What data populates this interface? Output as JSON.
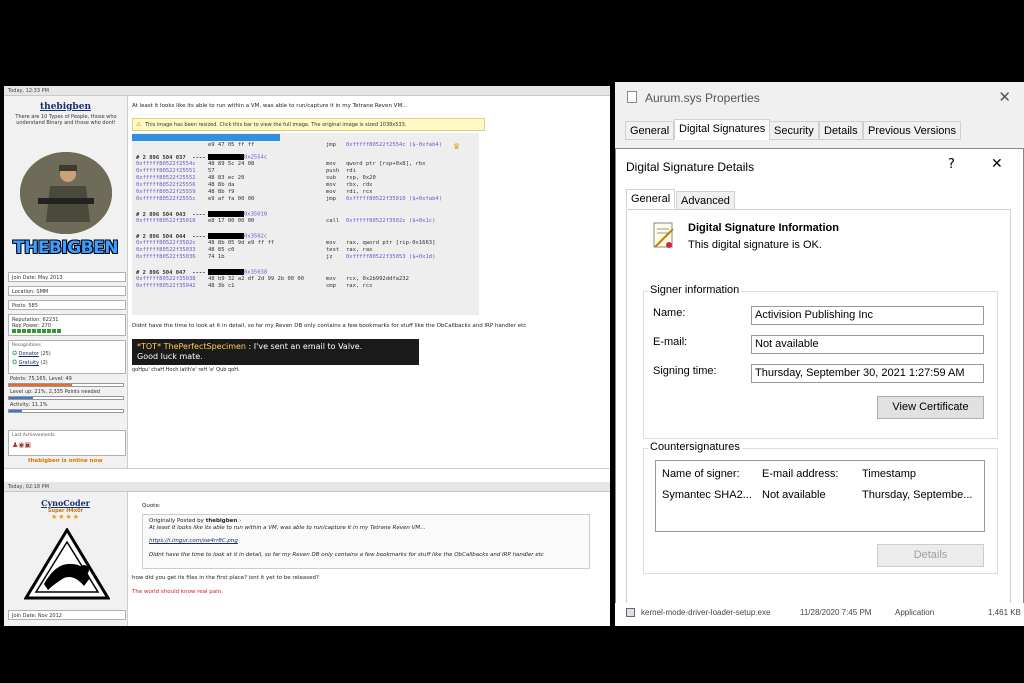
{
  "forum": {
    "post1": {
      "header": "Today, 12:33 PM",
      "username": "thebigben",
      "tagline": "There are 10 Types of People, those who understand Binary and those who dont!",
      "logo_text": "THEBIGBEN",
      "join_date": "Join Date: May 2013",
      "location": "Location: SMM",
      "posts": "Posts: 585",
      "reputation": "Reputation: 62231",
      "rep_power": "Rep Power: 270",
      "recognitions_title": "Recognitions",
      "recognitions": [
        {
          "label": "Donator",
          "count": "(25)"
        },
        {
          "label": "Gratuity",
          "count": "(2)"
        }
      ],
      "points": "Points: 75,165, Level: 49",
      "level_up": "Level up: 21%, 2,335 Points needed",
      "activity": "Activity: 11.1%",
      "points_fill": 0.55,
      "level_fill": 0.21,
      "activity_fill": 0.111,
      "achievements_title": "Last Achievements",
      "online_status": "thebigben is online now",
      "intro": "At least it looks like its able to run within a VM, was able to run/capture it in my Tetrane Reven VM...",
      "notice": "This image has been resized. Click this bar to view the full image. The original image is sized 1038x533.",
      "code_lines": [
        {
          "a": "# 2 896 504 036  ----",
          "b": "",
          "c": "",
          "d": ""
        },
        {
          "a": "",
          "b": "e9 47 05 ff ff",
          "c": "jmp",
          "d": "0xfffff80522f2554c ($-0xfab4)"
        },
        {
          "a": "# 2 896 504 037  ----",
          "b": "0x2554c",
          "c": "",
          "d": ""
        },
        {
          "a": "0xfffff80522f2554c",
          "b": "48 89 5c 24 08",
          "c": "mov",
          "d": "qword ptr [rsp+0x8], rbx"
        },
        {
          "a": "0xfffff80522f25551",
          "b": "57",
          "c": "push",
          "d": "rdi"
        },
        {
          "a": "0xfffff80522f25552",
          "b": "48 83 ec 20",
          "c": "sub",
          "d": "rsp, 0x20"
        },
        {
          "a": "0xfffff80522f25556",
          "b": "48 8b da",
          "c": "mov",
          "d": "rbx, rdx"
        },
        {
          "a": "0xfffff80522f25559",
          "b": "48 8b f9",
          "c": "mov",
          "d": "rdi, rcx"
        },
        {
          "a": "0xfffff80522f2555c",
          "b": "e9 af fa 00 00",
          "c": "jmp",
          "d": "0xfffff80522f35010 ($+0xfab4)"
        },
        {
          "a": "# 2 896 504 043  ----",
          "b": "0x35010",
          "c": "",
          "d": ""
        },
        {
          "a": "0xfffff80522f35010",
          "b": "e8 17 00 00 00",
          "c": "call",
          "d": "0xfffff80522f3502c ($+0x1c)"
        },
        {
          "a": "# 2 896 504 044  ----",
          "b": "0x3502c",
          "c": "",
          "d": ""
        },
        {
          "a": "0xfffff80522f3502c",
          "b": "48 8b 05 9d e9 ff ff",
          "c": "mov",
          "d": "rax, qword ptr [rip-0x1663]"
        },
        {
          "a": "0xfffff80522f35033",
          "b": "48 85 c0",
          "c": "test",
          "d": "rax, rax"
        },
        {
          "a": "0xfffff80522f35036",
          "b": "74 1b",
          "c": "jz",
          "d": "0xfffff80522f35053 ($+0x1d)"
        },
        {
          "a": "# 2 896 504 047  ----",
          "b": "0x35038",
          "c": "",
          "d": ""
        },
        {
          "a": "0xfffff80522f35038",
          "b": "48 b9 32 a2 df 2d 99 2b 00 00",
          "c": "mov",
          "d": "rcx, 0x2b992ddfa232"
        },
        {
          "a": "0xfffff80522f35042",
          "b": "48 3b c1",
          "c": "cmp",
          "d": "rax, rcx"
        }
      ],
      "after_code": "Didnt have the time to look at it in detail, so far my Reven DB only contains a few bookmarks for stuff like the ObCallbacks and IRP handler etc",
      "shout_name": "*TOT* ThePerfectSpecimen",
      "shout_text": " : I've sent an email to Valve.",
      "shout_text2": "Good luck mate.",
      "signature": "qoHpu' chaH Hoch latlh'e' reH 'e' Qub qoH."
    },
    "post2": {
      "header": "Today, 02:18 PM",
      "username": "CynoCoder",
      "rank": "Super H4x0r",
      "stars": "★★★★",
      "join_date": "Join Date: Nov 2012",
      "quote_label": "Quote:",
      "quote_by_prefix": "Originally Posted by ",
      "quote_by_name": "thebigben",
      "quote_line1": "At least it looks like its able to run within a VM, was able to run/capture it in my Tetrane Reven VM...",
      "quote_link": "https://i.imgur.com/sw4rr8C.png",
      "quote_line2": "Didnt have the time to look at it in detail, so far my Reven DB only contains a few bookmarks for stuff like the ObCallbacks and IRP handler etc",
      "reply": "how did you get its files in the first place? isnt it yet to be released?",
      "signature": "The world should know real pain."
    }
  },
  "dialog": {
    "outer_title": "Aurum.sys Properties",
    "outer_tabs": [
      "General",
      "Digital Signatures",
      "Security",
      "Details",
      "Previous Versions"
    ],
    "inner_title": "Digital Signature Details",
    "help": "?",
    "close": "✕",
    "inner_tabs": [
      "General",
      "Advanced"
    ],
    "info_title": "Digital Signature Information",
    "info_status": "This digital signature is OK.",
    "signer_group": "Signer information",
    "name_label": "Name:",
    "name_value": "Activision Publishing Inc",
    "email_label": "E-mail:",
    "email_value": "Not available",
    "time_label": "Signing time:",
    "time_value": "Thursday, September 30, 2021 1:27:59 AM",
    "view_cert": "View Certificate",
    "counter_group": "Countersignatures",
    "cols": [
      "Name of signer:",
      "E-mail address:",
      "Timestamp"
    ],
    "row": [
      "Symantec SHA2...",
      "Not available",
      "Thursday, Septembe..."
    ],
    "details": "Details"
  },
  "explorer": {
    "filename": "kernel-mode-driver-loader-setup.exe",
    "date": "11/28/2020 7:45 PM",
    "type": "Application",
    "size": "1,461 KB"
  }
}
